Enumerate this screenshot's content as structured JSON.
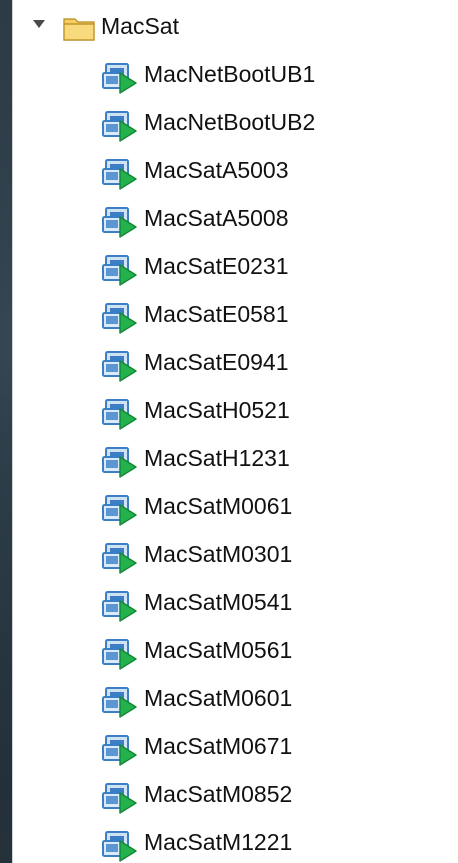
{
  "folder": {
    "name": "MacSat",
    "expanded": true,
    "icon": "folder-icon",
    "color": "#f2c453"
  },
  "vm_icon": "vm-poweredon-icon",
  "vm_icon_colors": {
    "screen": "#3d7fc7",
    "play": "#22b14c"
  },
  "items": [
    {
      "label": "MacNetBootUB1"
    },
    {
      "label": "MacNetBootUB2"
    },
    {
      "label": "MacSatA5003"
    },
    {
      "label": "MacSatA5008"
    },
    {
      "label": "MacSatE0231"
    },
    {
      "label": "MacSatE0581"
    },
    {
      "label": "MacSatE0941"
    },
    {
      "label": "MacSatH0521"
    },
    {
      "label": "MacSatH1231"
    },
    {
      "label": "MacSatM0061"
    },
    {
      "label": "MacSatM0301"
    },
    {
      "label": "MacSatM0541"
    },
    {
      "label": "MacSatM0561"
    },
    {
      "label": "MacSatM0601"
    },
    {
      "label": "MacSatM0671"
    },
    {
      "label": "MacSatM0852"
    },
    {
      "label": "MacSatM1221"
    }
  ]
}
